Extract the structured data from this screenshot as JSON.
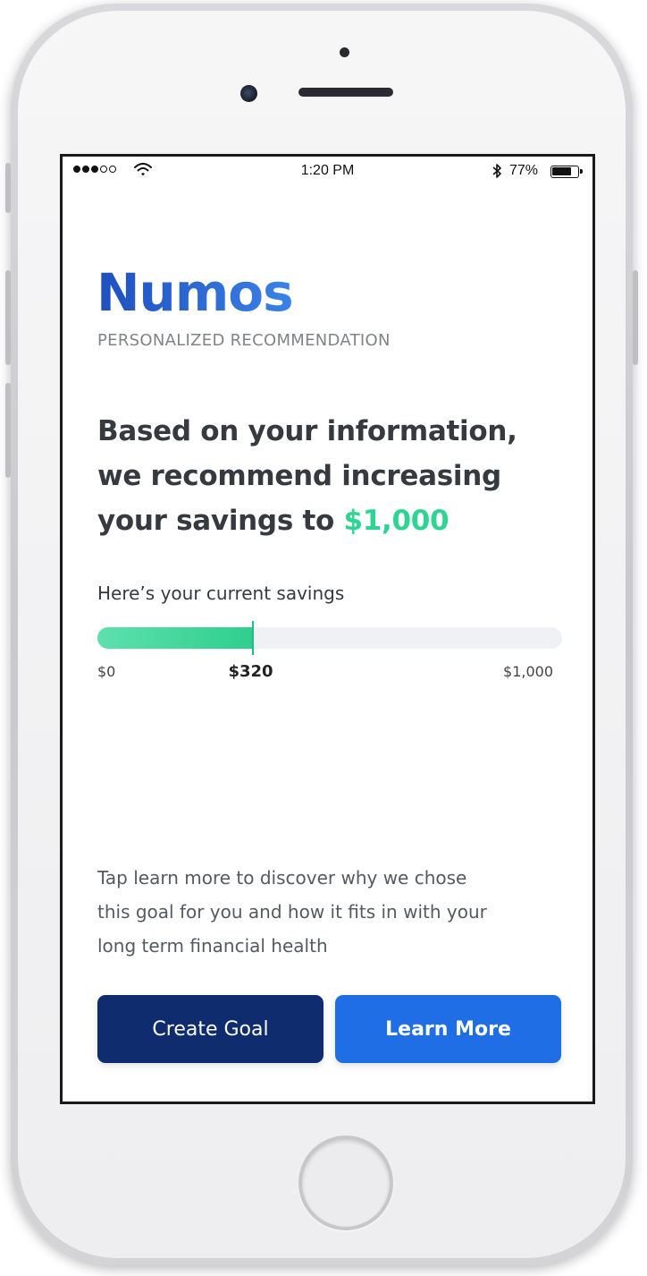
{
  "status_bar": {
    "signal_bars_filled": 3,
    "signal_bars_total": 5,
    "time": "1:20 PM",
    "battery_percent": "77%",
    "battery_level": 0.77,
    "bluetooth_icon": "bluetooth-icon",
    "wifi_icon": "wifi-icon"
  },
  "brand": {
    "name": "Numos",
    "subtitle": "PERSONALIZED RECOMMENDATION"
  },
  "recommendation": {
    "headline_line1": "Based on your information,",
    "headline_line2": "we recommend increasing",
    "headline_line3_prefix": "your savings to ",
    "amount": "$1,000"
  },
  "savings": {
    "label": "Here’s your current savings",
    "min_label": "$0",
    "current_label": "$320",
    "max_label": "$1,000",
    "current_value": 320,
    "max_value": 1000
  },
  "info": {
    "text_line1": "Tap learn more to discover why we chose",
    "text_line2": "this goal for you and how it fits in with your",
    "text_line3": "long term financial health"
  },
  "buttons": {
    "create_goal": "Create Goal",
    "learn_more": "Learn More"
  },
  "colors": {
    "brand_blue": "#2a63d6",
    "accent_green": "#2ed491",
    "create_button": "#0f2d6e",
    "learn_button": "#1f6ee6"
  }
}
